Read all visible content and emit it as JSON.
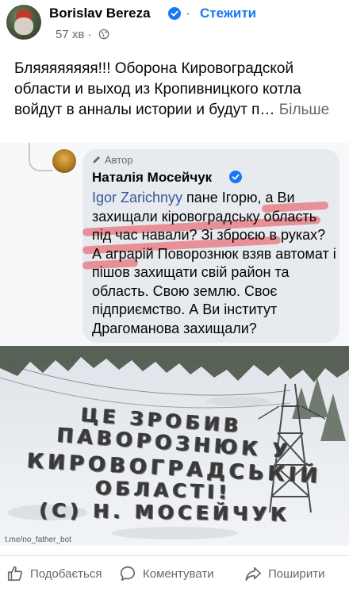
{
  "post": {
    "author": "Borislav Bereza",
    "follow": "Стежити",
    "separator": "·",
    "time": "57 хв",
    "time_dot": "·",
    "text": "Бляяяяяяяя!!! Оборона Кировоградской области и выход из Кропивницкого котла войдут в анналы истории и будут п…",
    "more": "Більше"
  },
  "comment": {
    "badge": "Автор",
    "author": "Наталія Мосейчук",
    "mention": "Igor Zarichnyy",
    "text": " пане Ігорю, а Ви захищали кіровоградську область під час навали? Зі зброєю в руках? А аграрій Поворознюк взяв автомат і пішов захищати свій район та область. Свою землю. Своє підприємство. А Ви інститут Драгоманова захищали?"
  },
  "photo": {
    "lines": [
      "ЦЕ ЗРОБИВ",
      "ПАВОРОЗНЮК У",
      "КИРОВОГРАДСЬКІЙ",
      "ОБЛАСТІ!",
      "(С) Н. МОСЕЙЧУК"
    ],
    "watermark": "t.me/no_father_bot"
  },
  "actions": {
    "like": "Подобається",
    "comment": "Коментувати",
    "share": "Поширити"
  },
  "colors": {
    "accent": "#1877f2",
    "marker": "#e84650"
  },
  "icons": [
    "verified-icon",
    "globe-icon",
    "pen-icon",
    "like-icon",
    "comment-icon",
    "share-icon"
  ]
}
